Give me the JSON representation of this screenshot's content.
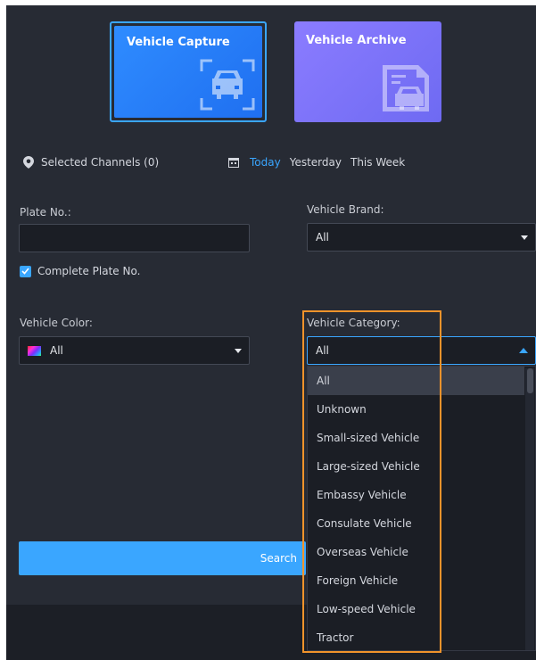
{
  "cards": {
    "capture": "Vehicle Capture",
    "archive": "Vehicle Archive"
  },
  "channels": {
    "label": "Selected Channels (0)",
    "icon": "location-pin-icon"
  },
  "date": {
    "icon": "calendar-icon",
    "today": "Today",
    "yesterday": "Yesterday",
    "this_week": "This Week"
  },
  "plate": {
    "label": "Plate No.:",
    "value": "",
    "complete_label": "Complete Plate No.",
    "complete_checked": true
  },
  "brand": {
    "label": "Vehicle Brand:",
    "value": "All"
  },
  "color": {
    "label": "Vehicle Color:",
    "value": "All"
  },
  "category": {
    "label": "Vehicle Category:",
    "value": "All",
    "options": [
      "All",
      "Unknown",
      "Small-sized Vehicle",
      "Large-sized Vehicle",
      "Embassy Vehicle",
      "Consulate Vehicle",
      "Overseas Vehicle",
      "Foreign Vehicle",
      "Low-speed Vehicle",
      "Tractor"
    ]
  },
  "search": {
    "label": "Search"
  },
  "colors": {
    "accent": "#3aa6ff",
    "panel_bg": "#272b34",
    "highlight": "#f0932b"
  }
}
